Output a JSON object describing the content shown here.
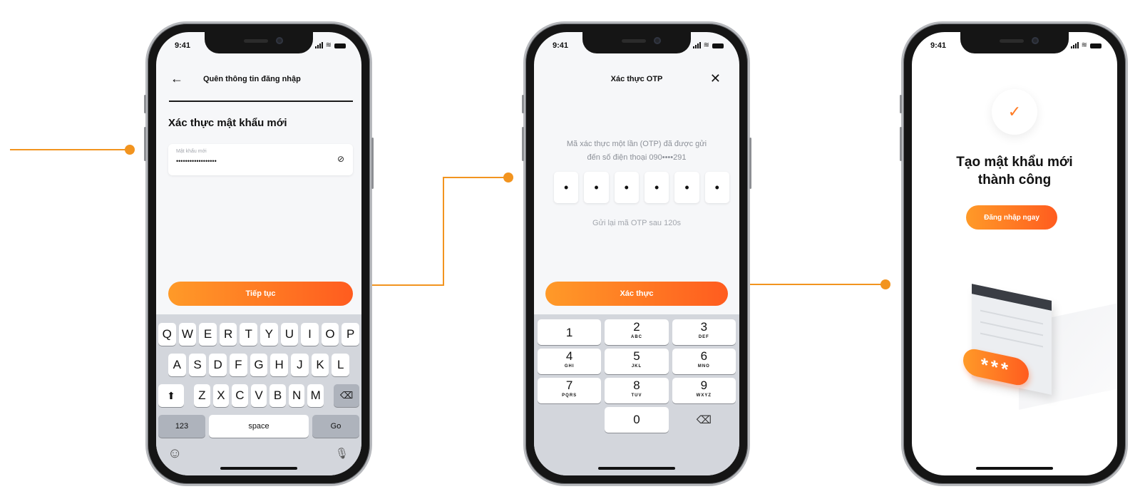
{
  "colors": {
    "accent": "#f2941f",
    "button_start": "#ff9a28",
    "button_end": "#ff5c1f"
  },
  "status_bar": {
    "time": "9:41"
  },
  "screen1": {
    "title": "Quên thông tin đăng nhập",
    "heading": "Xác thực mật khẩu mới",
    "password_label": "Mật khẩu mới",
    "password_value": "••••••••••••••••••",
    "continue_label": "Tiếp tục",
    "keyboard": {
      "row1": [
        "Q",
        "W",
        "E",
        "R",
        "T",
        "Y",
        "U",
        "I",
        "O",
        "P"
      ],
      "row2": [
        "A",
        "S",
        "D",
        "F",
        "G",
        "H",
        "J",
        "K",
        "L"
      ],
      "row3": [
        "Z",
        "X",
        "C",
        "V",
        "B",
        "N",
        "M"
      ],
      "numbers_label": "123",
      "space_label": "space",
      "go_label": "Go"
    }
  },
  "screen2": {
    "title": "Xác thực OTP",
    "message_line1": "Mã xác thực một lần (OTP) đã được gửi",
    "message_line2": "đến số điện thoại 090••••291",
    "otp_digits": [
      "•",
      "•",
      "•",
      "•",
      "•",
      "•"
    ],
    "resend_text": "Gửi lại mã OTP sau 120s",
    "verify_label": "Xác thực",
    "keypad": [
      {
        "digit": "1",
        "letters": ""
      },
      {
        "digit": "2",
        "letters": "ABC"
      },
      {
        "digit": "3",
        "letters": "DEF"
      },
      {
        "digit": "4",
        "letters": "GHI"
      },
      {
        "digit": "5",
        "letters": "JKL"
      },
      {
        "digit": "6",
        "letters": "MNO"
      },
      {
        "digit": "7",
        "letters": "PQRS"
      },
      {
        "digit": "8",
        "letters": "TUV"
      },
      {
        "digit": "9",
        "letters": "WXYZ"
      },
      {
        "digit": "0",
        "letters": ""
      }
    ]
  },
  "screen3": {
    "title_line1": "Tạo mật khẩu mới",
    "title_line2": "thành công",
    "login_label": "Đăng nhập ngay",
    "illustration_password": "***"
  }
}
